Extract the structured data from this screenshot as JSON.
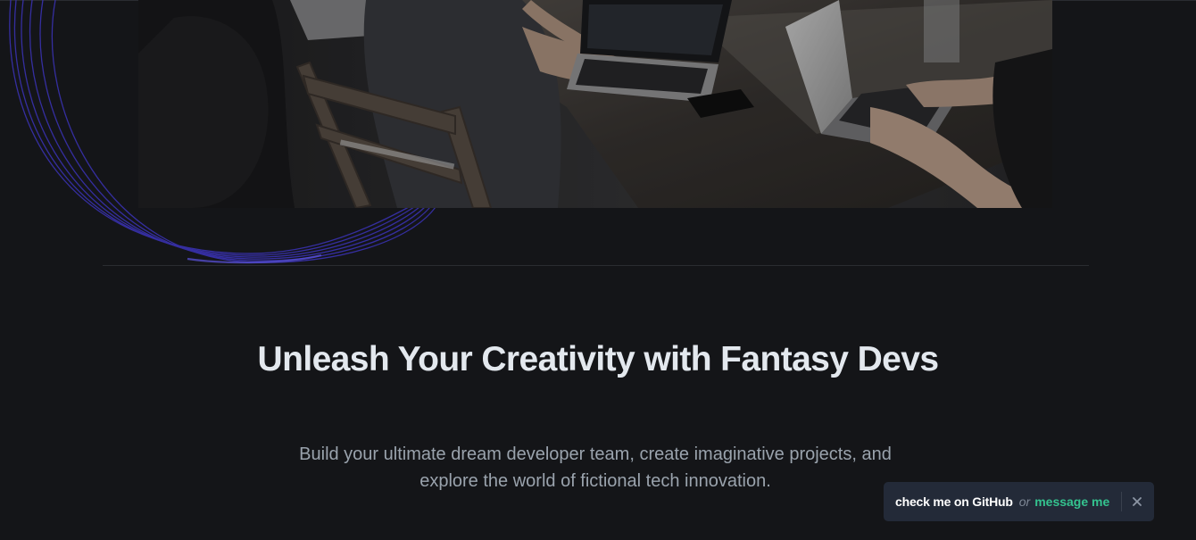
{
  "hero": {
    "image_description_icon": "team-coding-photo"
  },
  "main": {
    "headline": "Unleash Your Creativity with Fantasy Devs",
    "subtext": "Build your ultimate dream developer team, create imaginative projects, and explore the world of fictional tech innovation."
  },
  "toast": {
    "github_label": "check me on GitHub",
    "or_label": "or",
    "message_label": "message me",
    "close_icon": "close-icon"
  },
  "colors": {
    "background": "#141518",
    "headline": "#e3e8ee",
    "subtext": "#9aa3ad",
    "toast_bg": "#232a38",
    "accent_green": "#34c38f",
    "curve_purple": "#4338ca"
  }
}
